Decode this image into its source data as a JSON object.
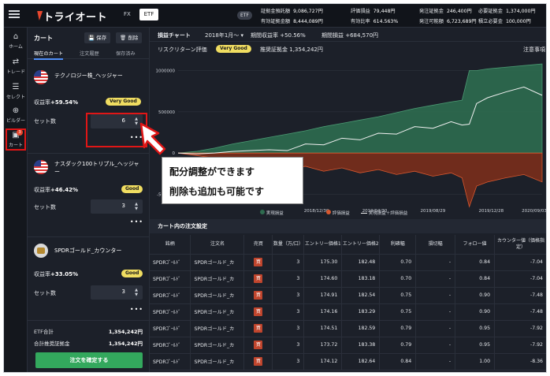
{
  "topbar": {
    "logo": "トライオート",
    "tabs": [
      "FX",
      "ETF"
    ],
    "badge": "ETF",
    "stats": [
      {
        "label": "証拠金預託額",
        "value": "9,086,727円"
      },
      {
        "label": "評価損益",
        "value": "79,448円"
      },
      {
        "label": "発注証拠金",
        "value": "246,400円"
      },
      {
        "label": "必要証拠金",
        "value": "1,374,000円"
      },
      {
        "label": "有効証拠金額",
        "value": "8,444,089円"
      },
      {
        "label": "有効比率",
        "value": "614.563%"
      },
      {
        "label": "発注可能額",
        "value": "6,723,689円"
      },
      {
        "label": "積立必要金",
        "value": "100,000円"
      }
    ]
  },
  "nav": [
    {
      "label": "ホーム",
      "icon": "home-icon",
      "glyph": "⌂"
    },
    {
      "label": "トレード",
      "icon": "trade-icon",
      "glyph": "⇄"
    },
    {
      "label": "セレクト",
      "icon": "select-icon",
      "glyph": "☰"
    },
    {
      "label": "ビルダー",
      "icon": "builder-icon",
      "glyph": "⊕"
    },
    {
      "label": "カート",
      "icon": "cart-icon",
      "glyph": "🛒",
      "badge": "3"
    }
  ],
  "cart": {
    "title": "カート",
    "save": "保存",
    "delete": "削除",
    "tabs": [
      "現在のカート",
      "注文履歴",
      "保存済み"
    ],
    "items": [
      {
        "name": "テクノロジー株_ヘッジャー",
        "rate_label": "収益率",
        "rate": "+59.54%",
        "badge": "Very Good",
        "set_label": "セット数",
        "sets": "6"
      },
      {
        "name": "ナスダック100トリプル_ヘッジャー",
        "rate_label": "収益率",
        "rate": "+46.42%",
        "badge": "Good",
        "set_label": "セット数",
        "sets": "3"
      },
      {
        "name": "SPDRゴールド_カウンター",
        "rate_label": "収益率",
        "rate": "+33.05%",
        "badge": "Good",
        "set_label": "セット数",
        "sets": "3"
      }
    ],
    "etf_total_label": "ETF合計",
    "etf_total": "1,354,242円",
    "margin_total_label": "合計推奨証拠金",
    "margin_total": "1,354,242円",
    "confirm": "注文を確定する"
  },
  "main": {
    "chart_title": "損益チャート",
    "period": "2018年1月〜",
    "period_rate_label": "期間収益率",
    "period_rate": "+50.56%",
    "period_pl_label": "期間損益",
    "period_pl": "+684,570円",
    "risk_label": "リスクリターン評価",
    "risk_badge": "Very Good",
    "rec_margin_label": "推奨証拠金",
    "rec_margin": "1,354,242円",
    "notes": "注意事項",
    "legend": [
      "実現損益",
      "評価損益",
      "実現損益＋評価損益"
    ],
    "orders_title": "カート内の注文設定"
  },
  "chart_data": {
    "type": "area",
    "yticks": [
      "1000000",
      "500000",
      "0",
      "-500000"
    ],
    "xticks": [
      "2018/12/30",
      "2019/04/30",
      "2019/08/29",
      "2019/12/28",
      "2020/09/03"
    ],
    "series": [
      {
        "name": "実現損益",
        "color": "#2e6b4f",
        "x": [
          0,
          5,
          10,
          15,
          20,
          25,
          30,
          35,
          40,
          45,
          50,
          55,
          60,
          65,
          70,
          75,
          78,
          80,
          82,
          85,
          90,
          95,
          100
        ],
        "values": [
          0,
          20000,
          60000,
          110000,
          150000,
          190000,
          230000,
          270000,
          320000,
          360000,
          400000,
          440000,
          490000,
          540000,
          580000,
          620000,
          640000,
          1000000,
          1000000,
          1020000,
          1040000,
          1060000,
          1080000
        ]
      },
      {
        "name": "評価損益",
        "color": "#9c3a22",
        "x": [
          0,
          5,
          10,
          15,
          20,
          25,
          30,
          35,
          40,
          45,
          50,
          55,
          60,
          65,
          70,
          75,
          78,
          80,
          82,
          85,
          90,
          95,
          100
        ],
        "values": [
          0,
          -30000,
          -60000,
          -90000,
          -120000,
          -150000,
          -200000,
          -160000,
          -220000,
          -180000,
          -240000,
          -200000,
          -260000,
          -220000,
          -280000,
          -240000,
          -300000,
          -650000,
          -400000,
          -350000,
          -300000,
          -260000,
          -350000
        ]
      },
      {
        "name": "実現損益＋評価損益",
        "color": "#f1f1f1",
        "x": [
          0,
          5,
          10,
          15,
          20,
          25,
          30,
          35,
          40,
          45,
          50,
          55,
          60,
          65,
          70,
          75,
          78,
          80,
          82,
          85,
          90,
          95,
          100
        ],
        "values": [
          0,
          -10000,
          0,
          20000,
          30000,
          40000,
          30000,
          110000,
          100000,
          180000,
          160000,
          240000,
          230000,
          320000,
          300000,
          380000,
          340000,
          350000,
          600000,
          670000,
          740000,
          800000,
          700000
        ]
      }
    ],
    "ylim": [
      -600000,
      1100000
    ]
  },
  "orders": {
    "headers": [
      "銘柄",
      "注文名",
      "売買",
      "数量（万/口）",
      "エントリー価格1",
      "エントリー価格2",
      "利確幅",
      "損切幅",
      "フォロー値",
      "カウンター値（価格指定）"
    ],
    "buy_label": "買",
    "rows": [
      [
        "SPDRｺﾞｰﾙﾄﾞ",
        "SPDRゴールド_カ",
        "3",
        "175.30",
        "182.48",
        "0.70",
        "-",
        "0.84",
        "-7.04"
      ],
      [
        "SPDRｺﾞｰﾙﾄﾞ",
        "SPDRゴールド_カ",
        "3",
        "174.60",
        "183.18",
        "0.70",
        "-",
        "0.84",
        "-7.04"
      ],
      [
        "SPDRｺﾞｰﾙﾄﾞ",
        "SPDRゴールド_カ",
        "3",
        "174.91",
        "182.54",
        "0.75",
        "-",
        "0.90",
        "-7.48"
      ],
      [
        "SPDRｺﾞｰﾙﾄﾞ",
        "SPDRゴールド_カ",
        "3",
        "174.16",
        "183.29",
        "0.75",
        "-",
        "0.90",
        "-7.48"
      ],
      [
        "SPDRｺﾞｰﾙﾄﾞ",
        "SPDRゴールド_カ",
        "3",
        "174.51",
        "182.59",
        "0.79",
        "-",
        "0.95",
        "-7.92"
      ],
      [
        "SPDRｺﾞｰﾙﾄﾞ",
        "SPDRゴールド_カ",
        "3",
        "173.72",
        "183.38",
        "0.79",
        "-",
        "0.95",
        "-7.92"
      ],
      [
        "SPDRｺﾞｰﾙﾄﾞ",
        "SPDRゴールド_カ",
        "3",
        "174.12",
        "182.64",
        "0.84",
        "-",
        "1.00",
        "-8.36"
      ]
    ]
  },
  "annotation": {
    "line1": "配分調整ができます",
    "line2": "削除も追加も可能です"
  }
}
